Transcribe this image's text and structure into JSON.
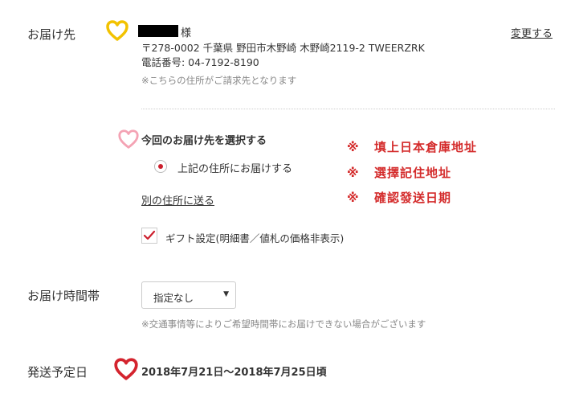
{
  "delivery": {
    "label": "お届け先",
    "name_suffix": "様",
    "postal_address": "〒278-0002 千葉県 野田市木野崎 木野崎2119-2 TWEERZRK",
    "phone": "電話番号: 04-7192-8190",
    "billing_note": "※こちらの住所がご請求先となります",
    "change_link": "変更する",
    "select_title": "今回のお届け先を選択する",
    "radio_option": "上記の住所にお届けする",
    "other_address_link": "別の住所に送る",
    "gift_setting": "ギフト設定(明細書／値札の価格非表示)",
    "gift_checked": true,
    "radio_selected": true
  },
  "annotations": {
    "mark": "※",
    "items": [
      "填上日本倉庫地址",
      "選擇記住地址",
      "確認發送日期"
    ]
  },
  "delivery_time": {
    "label": "お届け時間帯",
    "selected": "指定なし",
    "note": "※交通事情等によりご希望時間帯にお届けできない場合がございます"
  },
  "ship_date": {
    "label": "発送予定日",
    "value": "2018年7月21日〜2018年7月25日頃"
  },
  "colors": {
    "heart_yellow": "#f2c200",
    "heart_pink": "#f4a3b4",
    "heart_red": "#d4242e",
    "accent_red": "#cc1f2d",
    "annotation_red": "#d42b2b"
  },
  "icons": [
    "heart-icon",
    "radio-dot",
    "check-icon",
    "chevron-down-icon"
  ]
}
